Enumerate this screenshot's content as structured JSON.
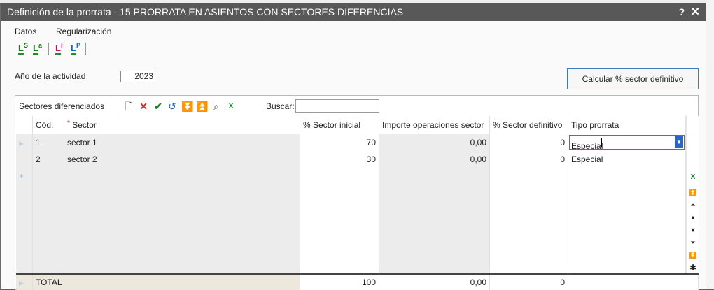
{
  "window": {
    "title": "Definición de la prorrata - 15 PRORRATA EN ASIENTOS CON SECTORES DIFERENCIAS",
    "help_label": "?",
    "close_label": "✕"
  },
  "menu": [
    {
      "label": "Datos"
    },
    {
      "label": "Regularización"
    }
  ],
  "iconbar": [
    {
      "letter": "L",
      "sup": "S",
      "color": "#1f7a1f",
      "icon": "ledger-s-icon"
    },
    {
      "letter": "L",
      "sup": "a",
      "color": "#1f7a1f",
      "icon": "ledger-a-icon"
    },
    {
      "letter": "L",
      "sup": "i",
      "color": "#c2185b",
      "icon": "ledger-i-icon"
    },
    {
      "letter": "L",
      "sup": "P",
      "color": "#1565c0",
      "icon": "ledger-p-icon"
    }
  ],
  "form": {
    "year_label": "Año de la actividad",
    "year_value": "2023",
    "calc_button": "Calcular % sector definitivo"
  },
  "panel": {
    "tab_label": "Sectores diferenciados",
    "search_label": "Buscar:",
    "search_value": ""
  },
  "table": {
    "columns": {
      "code": "Cód.",
      "sector": "Sector",
      "sector_inicial": "% Sector inicial",
      "importe": "Importe operaciones sector",
      "sector_definitivo": "% Sector definitivo",
      "tipo": "Tipo prorrata"
    },
    "required_mark": "*",
    "rows": [
      {
        "code": "1",
        "sector": "sector 1",
        "sector_inicial": "70",
        "importe": "0,00",
        "sector_definitivo": "0",
        "tipo": "Especial"
      },
      {
        "code": "2",
        "sector": "sector 2",
        "sector_inicial": "30",
        "importe": "0,00",
        "sector_definitivo": "0",
        "tipo": "Especial"
      }
    ],
    "new_row_marker": "+",
    "totals": {
      "label": "TOTAL",
      "sector_inicial": "100",
      "importe": "0,00",
      "sector_definitivo": "0"
    }
  },
  "colors": {
    "titlebar": "#585858",
    "accent": "#2a63c9",
    "total_label_bg": "#ece9dc"
  }
}
